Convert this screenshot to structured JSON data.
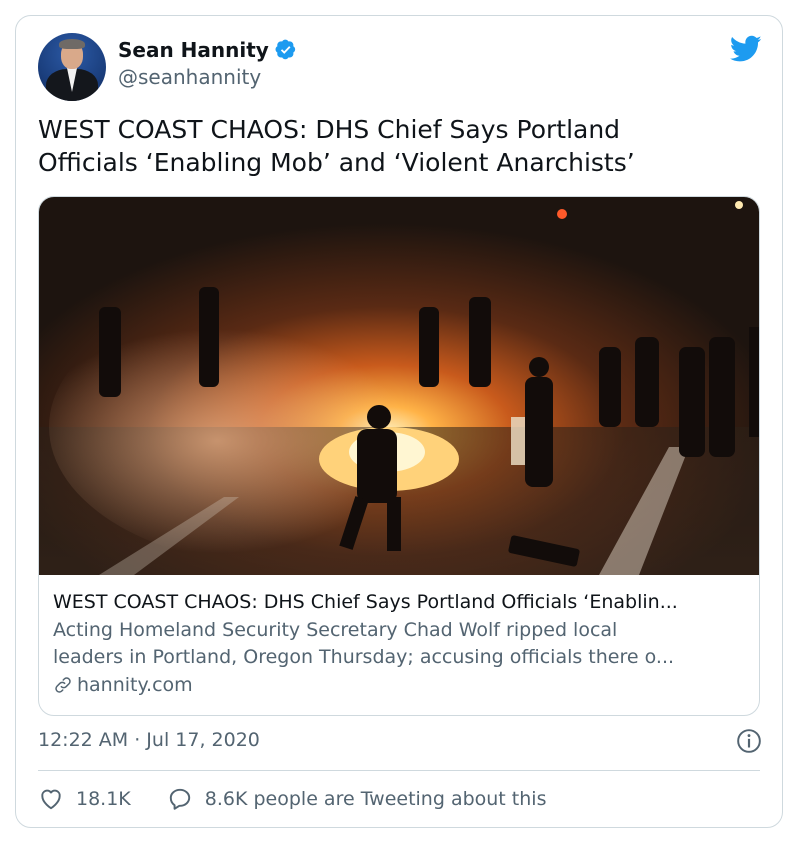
{
  "author": {
    "display_name": "Sean Hannity",
    "handle": "@seanhannity",
    "verified": true
  },
  "tweet": {
    "text_line1": "WEST COAST CHAOS: DHS Chief Says Portland",
    "text_line2": "Officials ‘Enabling Mob’ and ‘Violent Anarchists’"
  },
  "link_card": {
    "title": "WEST COAST CHAOS: DHS Chief Says Portland Officials ‘Enablin...",
    "description_line1": "Acting Homeland Security Secretary Chad Wolf ripped local",
    "description_line2": "leaders in Portland, Oregon Thursday; accusing officials there o...",
    "domain": "hannity.com"
  },
  "meta": {
    "timestamp": "12:22 AM · Jul 17, 2020"
  },
  "actions": {
    "likes": "18.1K",
    "tweeting_about": "8.6K people are Tweeting about this"
  },
  "colors": {
    "twitter_blue": "#1d9bf0",
    "secondary_text": "#536471",
    "border": "#cfd9de"
  },
  "icons": [
    "verified-icon",
    "twitter-bird-icon",
    "link-icon",
    "info-icon",
    "heart-icon",
    "reply-icon"
  ]
}
